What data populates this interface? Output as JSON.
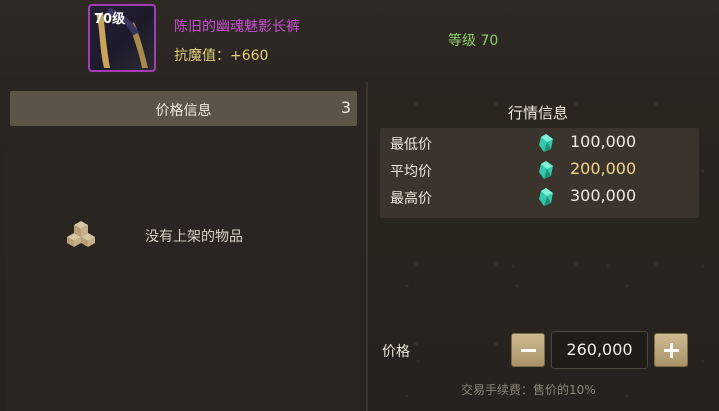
{
  "item": {
    "level_tag": "70级",
    "name": "陈旧的幽魂魅影长裤",
    "stat": "抗魔值：+660",
    "level": "等级 70"
  },
  "left_panel": {
    "title": "价格信息",
    "count": "3",
    "empty_text": "没有上架的物品",
    "empty_icon": "boxes-icon"
  },
  "right_panel": {
    "title": "行情信息",
    "currency_icon": "gem-icon",
    "rows": [
      {
        "label": "最低价",
        "value": "100,000"
      },
      {
        "label": "平均价",
        "value": "200,000"
      },
      {
        "label": "最高价",
        "value": "300,000"
      }
    ],
    "price_label": "价格",
    "price_value": "260,000",
    "fee_text": "交易手续费：售价的10%"
  },
  "colors": {
    "item_name": "#c84fd4",
    "stat": "#e2cf7c",
    "level": "#8ccf6f",
    "avg_value": "#f2d68a",
    "gem": "#37d3b4",
    "button": "#bfae83"
  }
}
